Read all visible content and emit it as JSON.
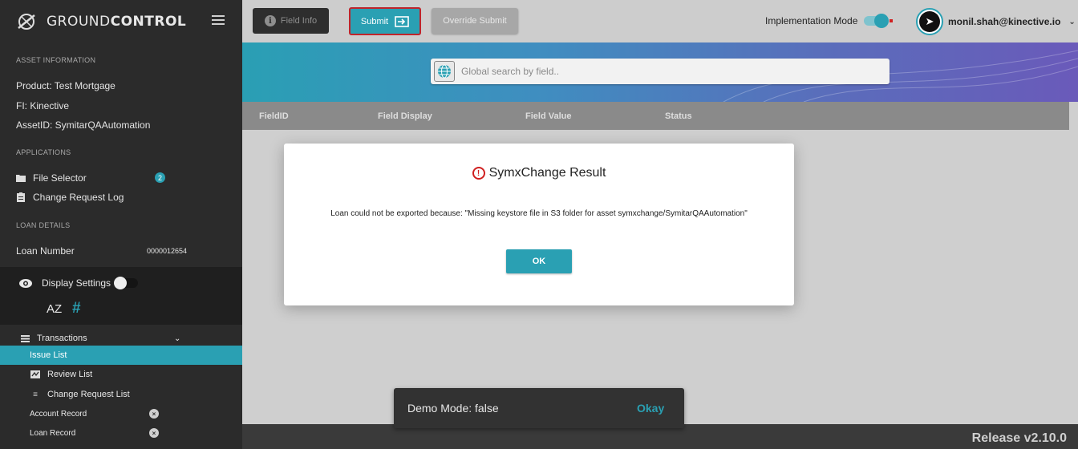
{
  "brand": {
    "name_light": "GROUND",
    "name_bold": "CONTROL"
  },
  "sidebar": {
    "asset_heading": "ASSET INFORMATION",
    "product": "Product:  Test Mortgage",
    "fi": "FI:  Kinective",
    "asset_id": "AssetID:  SymitarQAAutomation",
    "applications_heading": "APPLICATIONS",
    "file_selector": "File Selector",
    "file_selector_badge": "2",
    "change_request_log": "Change Request Log",
    "loan_heading": "LOAN DETAILS",
    "loan_number_label": "Loan Number",
    "loan_number_value": "0000012654",
    "display_settings": "Display Settings",
    "sort_icon_text": "AZ",
    "hash": "#",
    "transactions": "Transactions",
    "issue_list": "Issue List",
    "review_list": "Review List",
    "change_request_list": "Change Request List",
    "account_record": "Account Record",
    "loan_record": "Loan Record"
  },
  "toolbar": {
    "field_info": "Field Info",
    "submit": "Submit",
    "override_submit": "Override Submit",
    "implementation_mode": "Implementation Mode",
    "user_email": "monil.shah@kinective.io"
  },
  "search": {
    "placeholder": "Global search by field.."
  },
  "table": {
    "columns": [
      "FieldID",
      "Field Display",
      "Field Value",
      "Status"
    ]
  },
  "modal": {
    "title": "SymxChange Result",
    "message": "Loan could not be exported because: \"Missing keystore file in S3 folder for asset symxchange/SymitarQAAutomation\"",
    "ok": "OK"
  },
  "snackbar": {
    "text": "Demo Mode: false",
    "action": "Okay"
  },
  "footer": {
    "release": "Release v2.10.0"
  },
  "colors": {
    "accent": "#2aa0b3",
    "sidebar": "#2b2b2b",
    "alert": "#d02020"
  }
}
